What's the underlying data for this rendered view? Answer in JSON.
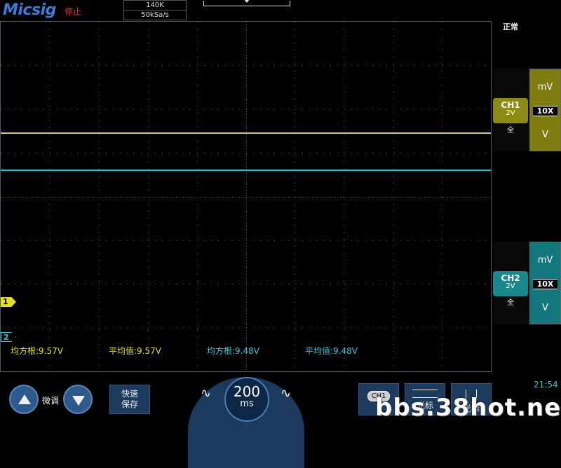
{
  "header": {
    "brand": "Micsig",
    "run_state": "停止",
    "memory_depth": "140K",
    "sample_rate": "50kSa/s"
  },
  "trigger_mode": "正常",
  "channels": [
    {
      "name": "CH1",
      "volts_per_div": "2V",
      "coupling": "全",
      "scale_up": "mV",
      "probe": "10X",
      "scale_down": "V",
      "color": "#e5df22",
      "marker": "1"
    },
    {
      "name": "CH2",
      "volts_per_div": "2V",
      "coupling": "全",
      "scale_up": "mV",
      "probe": "10X",
      "scale_down": "V",
      "color": "#3ac7d8",
      "marker": "2"
    }
  ],
  "measurements": [
    {
      "text": "均方根:9.57V"
    },
    {
      "text": "平均值:9.57V"
    },
    {
      "text": "均方根:9.48V"
    },
    {
      "text": "平均值:9.48V"
    }
  ],
  "controls": {
    "fine_adjust": "微调",
    "quick_save_line1": "快速",
    "quick_save_line2": "保存",
    "timebase_value": "200",
    "timebase_unit": "ms",
    "channel_select": "CH1",
    "cursor_h_label": "光标",
    "cursor_v_label": "光标"
  },
  "clock": "21:54",
  "watermark": "bbs.38hot.net",
  "colors": {
    "ch1": "#e5df22",
    "ch2": "#3ac7d8",
    "accent_blue": "#2d5a8c"
  }
}
